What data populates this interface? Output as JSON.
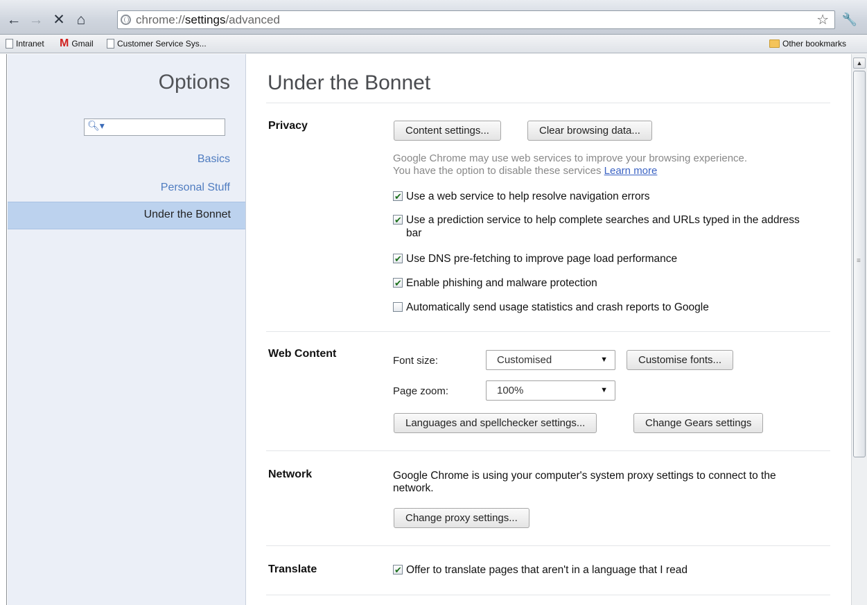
{
  "browser": {
    "address_prefix": "chrome://",
    "address_bold": "settings",
    "address_suffix": "/advanced",
    "bookmarks": [
      "Intranet",
      "Gmail",
      "Customer Service Sys..."
    ],
    "other_bookmarks": "Other bookmarks"
  },
  "sidebar": {
    "title": "Options",
    "search_placeholder": "",
    "items": [
      {
        "label": "Basics"
      },
      {
        "label": "Personal Stuff"
      },
      {
        "label": "Under the Bonnet"
      }
    ]
  },
  "page": {
    "title": "Under the Bonnet",
    "privacy": {
      "label": "Privacy",
      "content_settings": "Content settings...",
      "clear_browsing_data": "Clear browsing data...",
      "desc_line1": "Google Chrome may use web services to improve your browsing experience.",
      "desc_line2": "You have the option to disable these services",
      "learn_more": "Learn more",
      "checkboxes": [
        {
          "label": "Use a web service to help resolve navigation errors",
          "checked": true
        },
        {
          "label": "Use a prediction service to help complete searches and URLs typed in the address bar",
          "checked": true
        },
        {
          "label": "Use DNS pre-fetching to improve page load performance",
          "checked": true
        },
        {
          "label": "Enable phishing and malware protection",
          "checked": true
        },
        {
          "label": "Automatically send usage statistics and crash reports to Google",
          "checked": false
        }
      ]
    },
    "web_content": {
      "label": "Web Content",
      "font_size_label": "Font size:",
      "font_size_value": "Customised",
      "customise_fonts": "Customise fonts...",
      "page_zoom_label": "Page zoom:",
      "page_zoom_value": "100%",
      "languages_button": "Languages and spellchecker settings...",
      "gears_button": "Change Gears settings"
    },
    "network": {
      "label": "Network",
      "desc": "Google Chrome is using your computer's system proxy settings to connect to the network.",
      "proxy_button": "Change proxy settings..."
    },
    "translate": {
      "label": "Translate",
      "checkbox_label": "Offer to translate pages that aren't in a language that I read",
      "checked": true
    }
  },
  "colors": {
    "sidebar_bg": "#ebeff7",
    "sidebar_selected": "#bcd2ee",
    "link": "#4f7cc0"
  }
}
